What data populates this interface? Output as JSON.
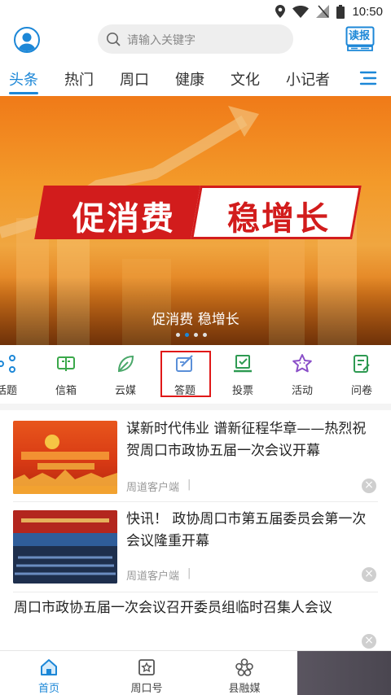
{
  "status_bar": {
    "time": "10:50"
  },
  "header": {
    "search_placeholder": "请输入关键字",
    "read_label": "读报"
  },
  "tabs": [
    {
      "label": "头条",
      "active": true
    },
    {
      "label": "热门"
    },
    {
      "label": "周口"
    },
    {
      "label": "健康"
    },
    {
      "label": "文化"
    },
    {
      "label": "小记者"
    }
  ],
  "banner": {
    "slogan_left": "促消费",
    "slogan_right": "稳增长",
    "caption": "促消费 稳增长",
    "slide_count": 4,
    "active_slide": 2
  },
  "quick_menu": [
    {
      "label": "话题",
      "icon": "topic-icon"
    },
    {
      "label": "信箱",
      "icon": "mailbox-icon"
    },
    {
      "label": "云媒",
      "icon": "leaf-icon"
    },
    {
      "label": "答题",
      "icon": "quiz-icon",
      "highlighted": true
    },
    {
      "label": "投票",
      "icon": "vote-icon"
    },
    {
      "label": "活动",
      "icon": "star-icon"
    },
    {
      "label": "问卷",
      "icon": "survey-icon"
    }
  ],
  "news": [
    {
      "title": "谋新时代伟业 谱新征程华章——热烈祝贺周口市政协五届一次会议开幕",
      "source": "周道客户端"
    },
    {
      "title": "快讯！ 政协周口市第五届委员会第一次会议隆重开幕",
      "source": "周道客户端"
    },
    {
      "title": "周口市政协五届一次会议召开委员组临时召集人会议",
      "source": ""
    }
  ],
  "bottom_nav": [
    {
      "label": "首页",
      "active": true
    },
    {
      "label": "周口号"
    },
    {
      "label": "县融媒"
    }
  ],
  "colors": {
    "accent": "#1c87d7",
    "highlight": "#e01818",
    "banner_red": "#d21c1c"
  }
}
